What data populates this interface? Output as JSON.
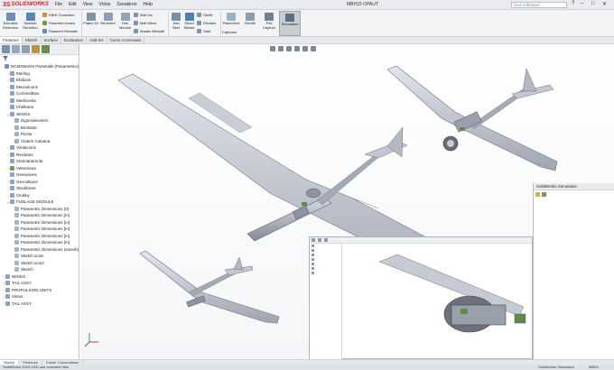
{
  "app": {
    "brand_ds": "3S",
    "brand_name": "SOLIDWORKS",
    "doc_title": "MBH15 OPAUT",
    "search_placeholder": "Sod Vdbbtaed"
  },
  "menus": [
    "File",
    "Edit",
    "View",
    "Vntos",
    "Szeakiroo",
    "Help"
  ],
  "toolbar": {
    "tools": [
      {
        "label": "Exbuded Renlution",
        "name": "extruded-boss-button",
        "color": "#6d8fb8"
      },
      {
        "label": "Swenke Renclticn",
        "name": "swept-boss-button",
        "color": "#5a84b5"
      },
      {
        "label": "Plates 40",
        "name": "plates-button",
        "color": "#7f93a8"
      },
      {
        "label": "Renelred",
        "name": "revolved-button",
        "color": "#8aa0b8"
      },
      {
        "label": "Hoe Module",
        "name": "hole-module-button",
        "color": "#92a4b9"
      },
      {
        "label": "Add Sket",
        "name": "add-sketch-button",
        "color": "#7a8fa6"
      },
      {
        "label": "Sheet Metals",
        "name": "sheet-metals-button",
        "color": "#4f7fb3"
      },
      {
        "label": "Placement",
        "name": "placement-button",
        "color": "#a0b0c3"
      },
      {
        "label": "Revlitri",
        "name": "revlitri-button",
        "color": "#8c9db0"
      },
      {
        "label": "Pell Capture",
        "name": "capture-button",
        "color": "#6e8197"
      },
      {
        "label": "Simulation",
        "name": "simulation-button",
        "color": "#5d6f85"
      }
    ],
    "rows": [
      {
        "label": "KBHI Conection",
        "name": "connection-command",
        "color": "#c2953a"
      },
      {
        "label": "Paramert lenses",
        "name": "parameter-lenses-command",
        "color": "#7d9b3c"
      },
      {
        "label": "Paaseert Revtatie",
        "name": "revtatie-command",
        "color": "#6b88ae"
      },
      {
        "label": "Mall Ins",
        "name": "mall-ins-command",
        "color": "#8095ad"
      },
      {
        "label": "Mall Minrs",
        "name": "mall-minrs-command",
        "color": "#8095ad"
      },
      {
        "label": "Maake Mleslatf",
        "name": "make-material-command",
        "color": "#8095ad"
      },
      {
        "label": "Skeltt",
        "name": "sketch-command",
        "color": "#8095ad"
      },
      {
        "label": "Elevane",
        "name": "elevane-command",
        "color": "#8095ad"
      },
      {
        "label": "Start",
        "name": "start-command",
        "color": "#8095ad"
      },
      {
        "label": "Captures",
        "name": "captures-command",
        "color": "#8095ad"
      }
    ]
  },
  "tabs": [
    "Features",
    "Sketch",
    "Surface",
    "Evaluation",
    "Add-Ins",
    "Curve Commaeis"
  ],
  "tree": [
    {
      "label": "DCMSWorks Paramalls (Pasametico)",
      "indent": 0,
      "toggle": "",
      "color": "#6f8fb6"
    },
    {
      "label": "Morling",
      "indent": 1,
      "toggle": "›",
      "color": "#8aa4c2"
    },
    {
      "label": "Ebdions",
      "indent": 1,
      "toggle": "›",
      "color": "#8aa4c2"
    },
    {
      "label": "Mevvoloons",
      "indent": 1,
      "toggle": "›",
      "color": "#8aa4c2"
    },
    {
      "label": "Commedties",
      "indent": 1,
      "toggle": "",
      "color": "#8aa4c2"
    },
    {
      "label": "Mediconita",
      "indent": 1,
      "toggle": "",
      "color": "#8aa4c2"
    },
    {
      "label": "Chelkana",
      "indent": 1,
      "toggle": "",
      "color": "#8aa4c2"
    },
    {
      "label": "WINGS",
      "indent": 1,
      "toggle": "⌄",
      "color": "#8aa4c2"
    },
    {
      "label": "Digmodecetors",
      "indent": 2,
      "toggle": "",
      "color": "#9bb1c9"
    },
    {
      "label": "Bestante",
      "indent": 2,
      "toggle": "",
      "color": "#9bb1c9"
    },
    {
      "label": "Picsta",
      "indent": 2,
      "toggle": "",
      "color": "#9bb1c9"
    },
    {
      "label": "Clatem Coleana",
      "indent": 2,
      "toggle": "",
      "color": "#9bb1c9"
    },
    {
      "label": "Vindacions",
      "indent": 1,
      "toggle": "›",
      "color": "#8aa4c2"
    },
    {
      "label": "Recistars",
      "indent": 1,
      "toggle": "›",
      "color": "#8aa4c2"
    },
    {
      "label": "Oinimanarnnla",
      "indent": 1,
      "toggle": "",
      "color": "#8aa4c2"
    },
    {
      "label": "Vetremena",
      "indent": 1,
      "toggle": "›",
      "color": "#7c9b52"
    },
    {
      "label": "Geeiunions",
      "indent": 1,
      "toggle": "",
      "color": "#8aa4c2"
    },
    {
      "label": "Gecnoltions",
      "indent": 1,
      "toggle": "›",
      "color": "#8aa4c2"
    },
    {
      "label": "Steckbrere",
      "indent": 1,
      "toggle": "›",
      "color": "#8aa4c2"
    },
    {
      "label": "Cloitiny",
      "indent": 1,
      "toggle": "›",
      "color": "#8aa4c2"
    },
    {
      "label": "FUSLAGE MODULE",
      "indent": 1,
      "toggle": "⌄",
      "color": "#8aa4c2"
    },
    {
      "label": "Parametric Dimensions (0)",
      "indent": 2,
      "toggle": "",
      "color": "#a7b5c4"
    },
    {
      "label": "Parametric Dimensions [m]",
      "indent": 2,
      "toggle": "",
      "color": "#a7b5c4"
    },
    {
      "label": "Parametric Dimensions [m]",
      "indent": 2,
      "toggle": "",
      "color": "#a7b5c4"
    },
    {
      "label": "Parametric Dimensions [m]",
      "indent": 2,
      "toggle": "",
      "color": "#a7b5c4"
    },
    {
      "label": "Parametric Dimensions [m]",
      "indent": 2,
      "toggle": "",
      "color": "#a7b5c4"
    },
    {
      "label": "Parametric Dimensions [m]",
      "indent": 2,
      "toggle": "",
      "color": "#a7b5c4"
    },
    {
      "label": "Parametric Dimensions (smesh)",
      "indent": 2,
      "toggle": "",
      "color": "#a7b5c4"
    },
    {
      "label": "Sketch icons",
      "indent": 2,
      "toggle": "",
      "color": "#a7b5c4"
    },
    {
      "label": "Sketch icon2",
      "indent": 2,
      "toggle": "",
      "color": "#a7b5c4"
    },
    {
      "label": "Sketch",
      "indent": 2,
      "toggle": "",
      "color": "#a7b5c4"
    },
    {
      "label": "WINGS",
      "indent": 0,
      "toggle": "›",
      "color": "#8aa4c2"
    },
    {
      "label": "TAIL ASSY",
      "indent": 0,
      "toggle": "›",
      "color": "#8aa4c2"
    },
    {
      "label": "PROPULSION UNITS",
      "indent": 0,
      "toggle": "›",
      "color": "#8aa4c2"
    },
    {
      "label": "Vintos",
      "indent": 0,
      "toggle": "›",
      "color": "#8aa4c2"
    },
    {
      "label": "TAIL ASSY",
      "indent": 0,
      "toggle": "›",
      "color": "#8aa4c2"
    }
  ],
  "sim_panel": {
    "title": "SolidWorks Simulation"
  },
  "bottom_tabs": [
    "Sketch",
    "Pevinoes",
    "Corser Convcrations"
  ],
  "status": {
    "left": "SolidWorks 2024 CAD uae conrared rtlss",
    "right_1": "SolidWorks Simulation",
    "right_2": "MBD1"
  }
}
